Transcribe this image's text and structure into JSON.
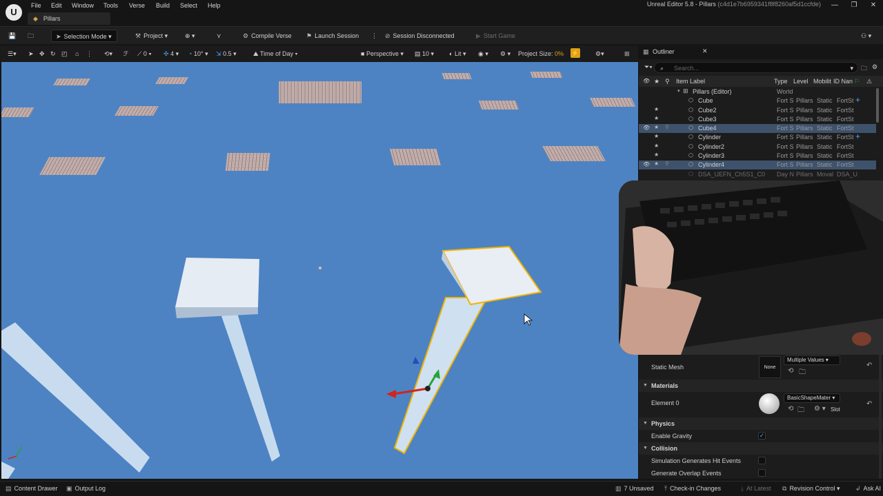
{
  "app": {
    "logo": "U",
    "title": "Unreal Editor 5.8 - Pillars",
    "hash": "(c4d1e7b6959341f8f8260af5d1ccfde)",
    "level_tab": "Pillars",
    "menu": [
      "File",
      "Edit",
      "Window",
      "Tools",
      "Verse",
      "Build",
      "Select",
      "Help"
    ]
  },
  "toolbar": {
    "selection_mode": "Selection Mode",
    "project": "Project",
    "compile_verse": "Compile Verse",
    "launch_session": "Launch Session",
    "session_status": "Session Disconnected",
    "start_game": "Start Game"
  },
  "viewport_toolbar": {
    "translate_snap": "0",
    "grid_snap": "4",
    "rotate_snap": "10°",
    "scale_snap": "0.5",
    "time_of_day": "Time of Day",
    "perspective": "Perspective",
    "camera_speed": "10",
    "view_mode": "Lit",
    "project_size_label": "Project Size:",
    "project_size_value": "0%"
  },
  "outliner": {
    "title": "Outliner",
    "search_placeholder": "Search...",
    "columns": [
      "Item Label",
      "Type",
      "Level",
      "Mobilit",
      "ID Nan"
    ],
    "root": {
      "label": "Pillars (Editor)",
      "type": "World"
    },
    "rows": [
      {
        "label": "Cube",
        "type": "Fort S",
        "level": "Pillars",
        "mobility": "Static",
        "id": "FortSt"
      },
      {
        "label": "Cube2",
        "type": "Fort S",
        "level": "Pillars",
        "mobility": "Static",
        "id": "FortSt"
      },
      {
        "label": "Cube3",
        "type": "Fort S",
        "level": "Pillars",
        "mobility": "Static",
        "id": "FortSt"
      },
      {
        "label": "Cube4",
        "type": "Fort S",
        "level": "Pillars",
        "mobility": "Static",
        "id": "FortSt"
      },
      {
        "label": "Cylinder",
        "type": "Fort S",
        "level": "Pillars",
        "mobility": "Static",
        "id": "FortSt"
      },
      {
        "label": "Cylinder2",
        "type": "Fort S",
        "level": "Pillars",
        "mobility": "Static",
        "id": "FortSt"
      },
      {
        "label": "Cylinder3",
        "type": "Fort S",
        "level": "Pillars",
        "mobility": "Static",
        "id": "FortSt"
      },
      {
        "label": "Cylinder4",
        "type": "Fort S",
        "level": "Pillars",
        "mobility": "Static",
        "id": "FortSt"
      },
      {
        "label": "DSA_UEFN_Ch5S1_C0",
        "type": "Day N",
        "level": "Pillars",
        "mobility": "Moval",
        "id": "DSA_U"
      }
    ]
  },
  "details": {
    "static_mesh_label": "Static Mesh",
    "static_mesh_thumb": "None",
    "static_mesh_value": "Multiple Values",
    "materials_section": "Materials",
    "element0_label": "Element 0",
    "element0_value": "BasicShapeMater",
    "slot_label": "Slot",
    "physics_section": "Physics",
    "enable_gravity_label": "Enable Gravity",
    "collision_section": "Collision",
    "sim_hit_label": "Simulation Generates Hit Events",
    "overlap_label": "Generate Overlap Events"
  },
  "statusbar": {
    "content_drawer": "Content Drawer",
    "output_log": "Output Log",
    "unsaved": "7 Unsaved",
    "checkin": "Check-in Changes",
    "at_latest": "At Latest",
    "revision_control": "Revision Control",
    "ask_ai": "Ask AI"
  },
  "colors": {
    "viewport_sky": "#4d83c3",
    "selection_outline": "#f0b400",
    "selected_row": "#3e526b",
    "accent_blue": "#49a8ff"
  }
}
